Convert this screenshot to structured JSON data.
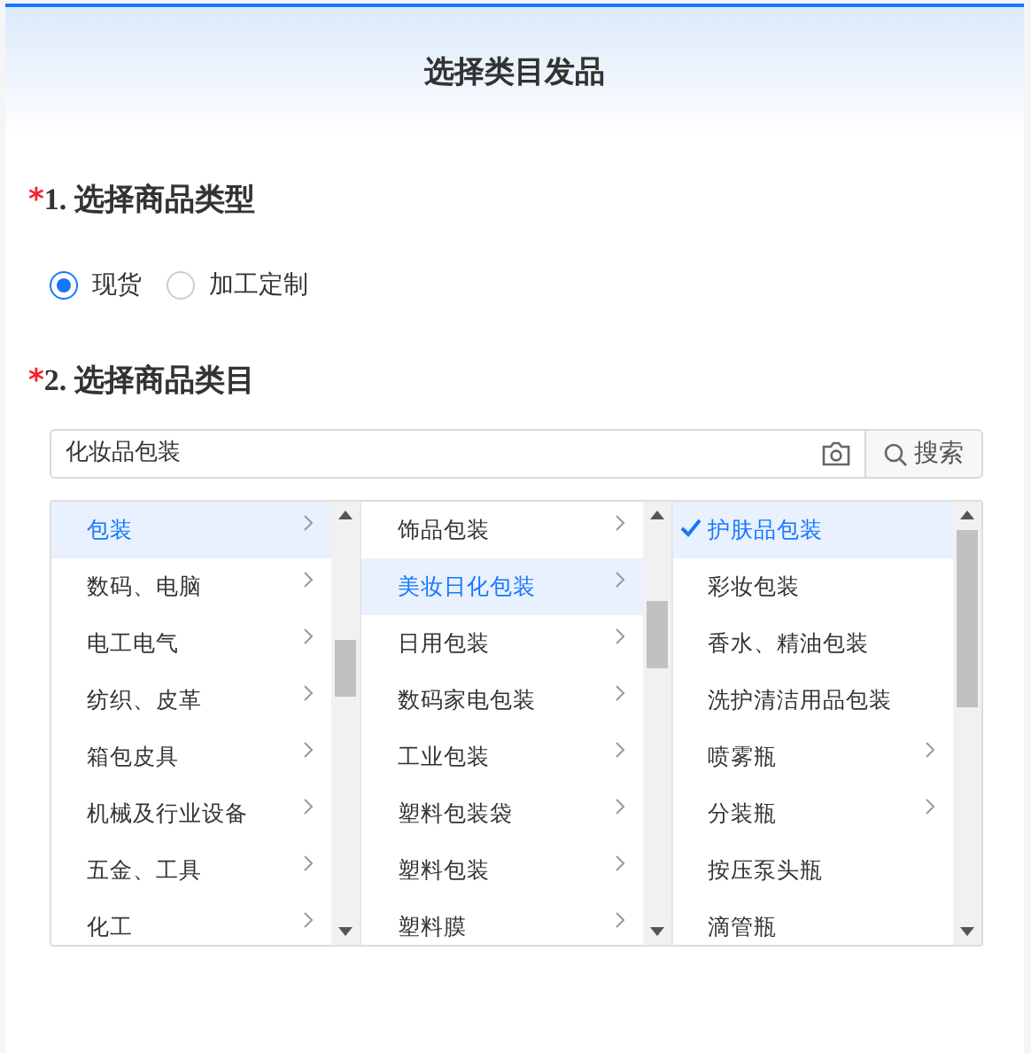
{
  "dialog": {
    "title": "选择类目发品"
  },
  "type_section": {
    "required_mark": "*",
    "heading": "1. 选择商品类型",
    "options": [
      {
        "label": "现货",
        "selected": true
      },
      {
        "label": "加工定制",
        "selected": false
      }
    ]
  },
  "category_section": {
    "required_mark": "*",
    "heading": "2. 选择商品类目",
    "search": {
      "value": "化妆品包装",
      "button": "搜索"
    },
    "columns": [
      {
        "items": [
          {
            "label": "包装",
            "selected": true,
            "has_children": true
          },
          {
            "label": "数码、电脑",
            "selected": false,
            "has_children": true
          },
          {
            "label": "电工电气",
            "selected": false,
            "has_children": true
          },
          {
            "label": "纺织、皮革",
            "selected": false,
            "has_children": true
          },
          {
            "label": "箱包皮具",
            "selected": false,
            "has_children": true
          },
          {
            "label": "机械及行业设备",
            "selected": false,
            "has_children": true
          },
          {
            "label": "五金、工具",
            "selected": false,
            "has_children": true
          },
          {
            "label": "化工",
            "selected": false,
            "has_children": true
          }
        ]
      },
      {
        "items": [
          {
            "label": "饰品包装",
            "selected": false,
            "has_children": true
          },
          {
            "label": "美妆日化包装",
            "selected": true,
            "has_children": true
          },
          {
            "label": "日用包装",
            "selected": false,
            "has_children": true
          },
          {
            "label": "数码家电包装",
            "selected": false,
            "has_children": true
          },
          {
            "label": "工业包装",
            "selected": false,
            "has_children": true
          },
          {
            "label": "塑料包装袋",
            "selected": false,
            "has_children": true
          },
          {
            "label": "塑料包装",
            "selected": false,
            "has_children": true
          },
          {
            "label": "塑料膜",
            "selected": false,
            "has_children": true
          }
        ]
      },
      {
        "items": [
          {
            "label": "护肤品包装",
            "selected": true,
            "has_children": false
          },
          {
            "label": "彩妆包装",
            "selected": false,
            "has_children": false
          },
          {
            "label": "香水、精油包装",
            "selected": false,
            "has_children": false
          },
          {
            "label": "洗护清洁用品包装",
            "selected": false,
            "has_children": false
          },
          {
            "label": "喷雾瓶",
            "selected": false,
            "has_children": true
          },
          {
            "label": "分装瓶",
            "selected": false,
            "has_children": true
          },
          {
            "label": "按压泵头瓶",
            "selected": false,
            "has_children": false
          },
          {
            "label": "滴管瓶",
            "selected": false,
            "has_children": false
          }
        ]
      }
    ]
  }
}
